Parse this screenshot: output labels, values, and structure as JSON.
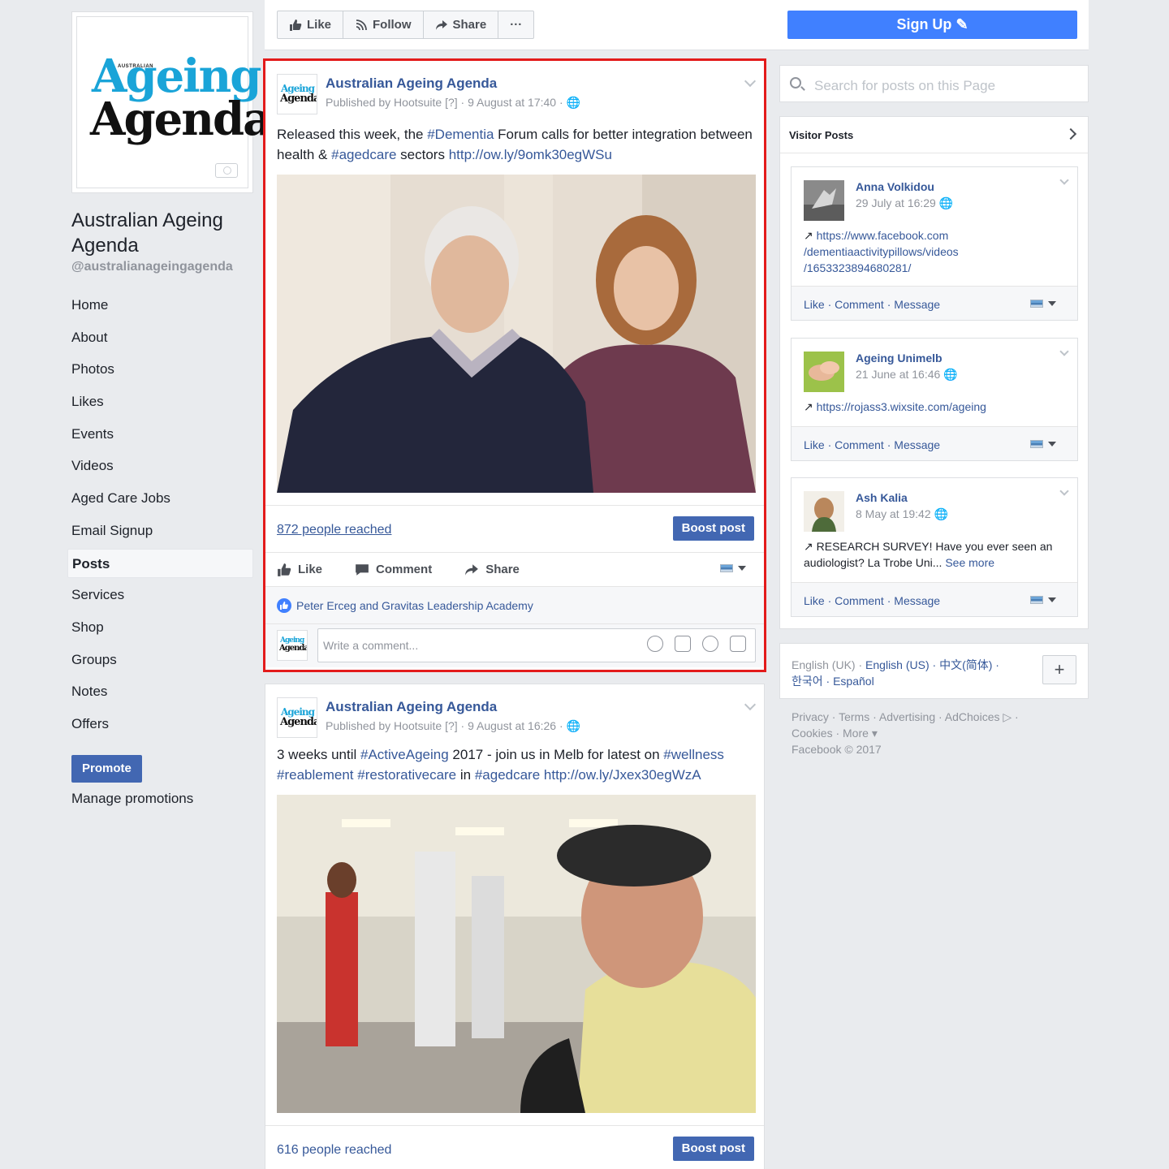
{
  "page": {
    "logo_small": "AUSTRALIAN",
    "logo_line1": "Ageing",
    "logo_line2": "Agenda",
    "name": "Australian Ageing Agenda",
    "handle": "@australianageingagenda"
  },
  "nav": {
    "items": [
      "Home",
      "About",
      "Photos",
      "Likes",
      "Events",
      "Videos",
      "Aged Care Jobs",
      "Email Signup",
      "Posts",
      "Services",
      "Shop",
      "Groups",
      "Notes",
      "Offers"
    ],
    "active": "Posts",
    "promote_label": "Promote",
    "manage_label": "Manage promotions"
  },
  "topbar": {
    "like": "Like",
    "follow": "Follow",
    "share": "Share",
    "more": "···",
    "signup": "Sign Up"
  },
  "posts": [
    {
      "author": "Australian Ageing Agenda",
      "meta": "Published by Hootsuite [?] · 9 August at 17:40 ·",
      "text_parts": [
        "Released this week, the ",
        "#Dementia",
        " Forum calls for better integration between health & ",
        "#agedcare",
        " sectors ",
        "http://ow.ly/9omk30egWSu"
      ],
      "reach": "872 people reached",
      "boost": "Boost post",
      "like": "Like",
      "comment": "Comment",
      "share": "Share",
      "likers": "Peter Erceg and Gravitas Leadership Academy",
      "comment_placeholder": "Write a comment..."
    },
    {
      "author": "Australian Ageing Agenda",
      "meta": "Published by Hootsuite [?] · 9 August at 16:26 ·",
      "text_parts": [
        "3 weeks until ",
        "#ActiveAgeing",
        " 2017 - join us in Melb for latest on ",
        "#wellness",
        " ",
        "#reablement",
        " ",
        "#restorativecare",
        " in ",
        "#agedcare",
        " ",
        "http://ow.ly/Jxex30egWzA"
      ],
      "reach": "616 people reached",
      "boost": "Boost post"
    }
  ],
  "search": {
    "placeholder": "Search for posts on this Page"
  },
  "visitor_posts": {
    "title": "Visitor Posts",
    "items": [
      {
        "name": "Anna Volkidou",
        "date": "29 July at 16:29",
        "text": "https://www.facebook.com/dementiaactivitypillows/videos/1653323894680281/",
        "line1": "https://www.facebook.com",
        "line2": "/dementiaactivitypillows/videos",
        "line3": "/1653323894680281/"
      },
      {
        "name": "Ageing Unimelb",
        "date": "21 June at 16:46",
        "line1": "https://rojass3.wixsite.com/ageing"
      },
      {
        "name": "Ash Kalia",
        "date": "8 May at 19:42",
        "line1": "RESEARCH SURVEY! Have you ever seen an",
        "line2": "audiologist? La Trobe Uni...",
        "see_more": "See more"
      }
    ],
    "footer_like": "Like",
    "footer_comment": "Comment",
    "footer_message": "Message"
  },
  "languages": {
    "current": "English (UK)",
    "others_line1": "English (US) · 中文(简体) ·",
    "others_line2": "한국어 · Español",
    "plus": "+"
  },
  "footer": {
    "line1": "Privacy · Terms · Advertising · AdChoices",
    "line2": "Cookies · More",
    "line3": "Facebook © 2017"
  },
  "colors": {
    "fb_blue": "#4267b2",
    "signup_blue": "#4080ff",
    "link": "#365899",
    "highlight_border": "#e31b1b",
    "logo_cyan": "#1aa4d8"
  }
}
